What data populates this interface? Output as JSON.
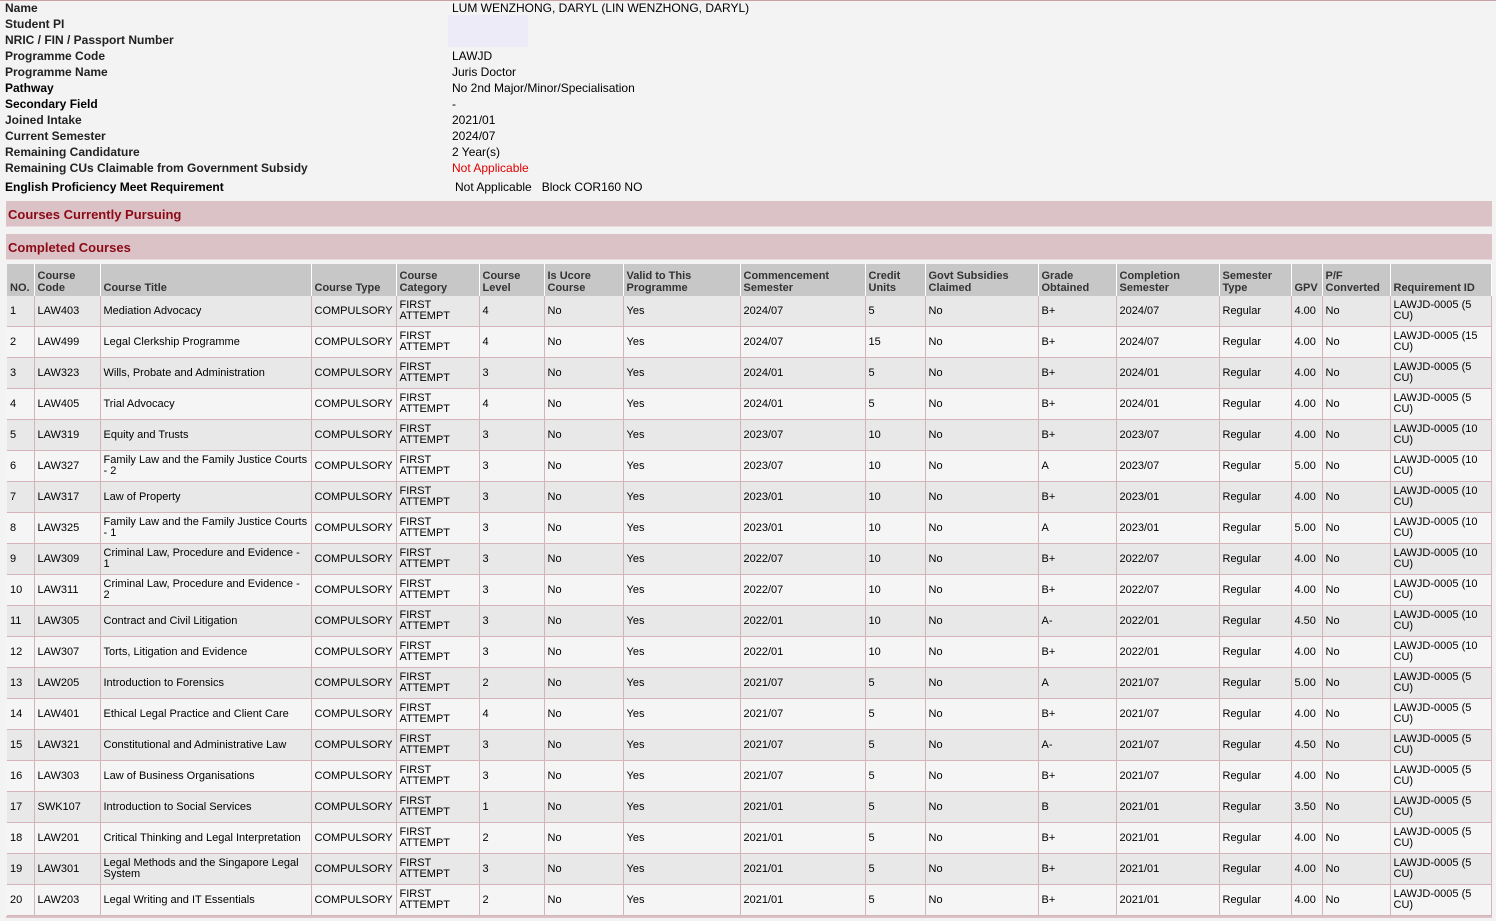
{
  "student_info": [
    {
      "label": "Name",
      "value": "LUM WENZHONG, DARYL (LIN WENZHONG, DARYL)"
    },
    {
      "label": "Student PI",
      "value": ""
    },
    {
      "label": "NRIC / FIN / Passport Number",
      "value": ""
    },
    {
      "label": "Programme Code",
      "value": "LAWJD"
    },
    {
      "label": "Programme Name",
      "value": "Juris Doctor"
    },
    {
      "label": "Pathway",
      "value": "No 2nd Major/Minor/Specialisation"
    },
    {
      "label": "Secondary Field",
      "value": "-"
    },
    {
      "label": "Joined Intake",
      "value": "2021/01"
    },
    {
      "label": "Current Semester",
      "value": "2024/07"
    },
    {
      "label": "Remaining Candidature",
      "value": "2 Year(s)"
    },
    {
      "label": "Remaining CUs Claimable from Government Subsidy",
      "value": "Not Applicable"
    },
    {
      "label": "English Proficiency Meet Requirement",
      "value": "Not Applicable   Block COR160 NO"
    }
  ],
  "sections": {
    "current": "Courses Currently Pursuing",
    "completed": "Completed Courses"
  },
  "columns": [
    "NO.",
    "Course Code",
    "Course Title",
    "Course Type",
    "Course Category",
    "Course Level",
    "Is Ucore Course",
    "Valid to This Programme",
    "Commencement Semester",
    "Credit Units",
    "Govt Subsidies Claimed",
    "Grade Obtained",
    "Completion Semester",
    "Semester Type",
    "GPV",
    "P/F Converted",
    "Requirement ID"
  ],
  "courses": [
    [
      "1",
      "LAW403",
      "Mediation Advocacy",
      "COMPULSORY",
      "FIRST ATTEMPT",
      "4",
      "No",
      "Yes",
      "2024/07",
      "5",
      "No",
      "B+",
      "2024/07",
      "Regular",
      "4.00",
      "No",
      "LAWJD-0005 (5 CU)"
    ],
    [
      "2",
      "LAW499",
      "Legal Clerkship Programme",
      "COMPULSORY",
      "FIRST ATTEMPT",
      "4",
      "No",
      "Yes",
      "2024/07",
      "15",
      "No",
      "B+",
      "2024/07",
      "Regular",
      "4.00",
      "No",
      "LAWJD-0005 (15 CU)"
    ],
    [
      "3",
      "LAW323",
      "Wills, Probate and Administration",
      "COMPULSORY",
      "FIRST ATTEMPT",
      "3",
      "No",
      "Yes",
      "2024/01",
      "5",
      "No",
      "B+",
      "2024/01",
      "Regular",
      "4.00",
      "No",
      "LAWJD-0005 (5 CU)"
    ],
    [
      "4",
      "LAW405",
      "Trial Advocacy",
      "COMPULSORY",
      "FIRST ATTEMPT",
      "4",
      "No",
      "Yes",
      "2024/01",
      "5",
      "No",
      "B+",
      "2024/01",
      "Regular",
      "4.00",
      "No",
      "LAWJD-0005 (5 CU)"
    ],
    [
      "5",
      "LAW319",
      "Equity and Trusts",
      "COMPULSORY",
      "FIRST ATTEMPT",
      "3",
      "No",
      "Yes",
      "2023/07",
      "10",
      "No",
      "B+",
      "2023/07",
      "Regular",
      "4.00",
      "No",
      "LAWJD-0005 (10 CU)"
    ],
    [
      "6",
      "LAW327",
      "Family Law and the Family Justice Courts - 2",
      "COMPULSORY",
      "FIRST ATTEMPT",
      "3",
      "No",
      "Yes",
      "2023/07",
      "10",
      "No",
      "A",
      "2023/07",
      "Regular",
      "5.00",
      "No",
      "LAWJD-0005 (10 CU)"
    ],
    [
      "7",
      "LAW317",
      "Law of Property",
      "COMPULSORY",
      "FIRST ATTEMPT",
      "3",
      "No",
      "Yes",
      "2023/01",
      "10",
      "No",
      "B+",
      "2023/01",
      "Regular",
      "4.00",
      "No",
      "LAWJD-0005 (10 CU)"
    ],
    [
      "8",
      "LAW325",
      "Family Law and the Family Justice Courts - 1",
      "COMPULSORY",
      "FIRST ATTEMPT",
      "3",
      "No",
      "Yes",
      "2023/01",
      "10",
      "No",
      "A",
      "2023/01",
      "Regular",
      "5.00",
      "No",
      "LAWJD-0005 (10 CU)"
    ],
    [
      "9",
      "LAW309",
      "Criminal Law, Procedure and Evidence - 1",
      "COMPULSORY",
      "FIRST ATTEMPT",
      "3",
      "No",
      "Yes",
      "2022/07",
      "10",
      "No",
      "B+",
      "2022/07",
      "Regular",
      "4.00",
      "No",
      "LAWJD-0005 (10 CU)"
    ],
    [
      "10",
      "LAW311",
      "Criminal Law, Procedure and Evidence - 2",
      "COMPULSORY",
      "FIRST ATTEMPT",
      "3",
      "No",
      "Yes",
      "2022/07",
      "10",
      "No",
      "B+",
      "2022/07",
      "Regular",
      "4.00",
      "No",
      "LAWJD-0005 (10 CU)"
    ],
    [
      "11",
      "LAW305",
      "Contract and Civil Litigation",
      "COMPULSORY",
      "FIRST ATTEMPT",
      "3",
      "No",
      "Yes",
      "2022/01",
      "10",
      "No",
      "A-",
      "2022/01",
      "Regular",
      "4.50",
      "No",
      "LAWJD-0005 (10 CU)"
    ],
    [
      "12",
      "LAW307",
      "Torts, Litigation and Evidence",
      "COMPULSORY",
      "FIRST ATTEMPT",
      "3",
      "No",
      "Yes",
      "2022/01",
      "10",
      "No",
      "B+",
      "2022/01",
      "Regular",
      "4.00",
      "No",
      "LAWJD-0005 (10 CU)"
    ],
    [
      "13",
      "LAW205",
      "Introduction to Forensics",
      "COMPULSORY",
      "FIRST ATTEMPT",
      "2",
      "No",
      "Yes",
      "2021/07",
      "5",
      "No",
      "A",
      "2021/07",
      "Regular",
      "5.00",
      "No",
      "LAWJD-0005 (5 CU)"
    ],
    [
      "14",
      "LAW401",
      "Ethical Legal Practice and Client Care",
      "COMPULSORY",
      "FIRST ATTEMPT",
      "4",
      "No",
      "Yes",
      "2021/07",
      "5",
      "No",
      "B+",
      "2021/07",
      "Regular",
      "4.00",
      "No",
      "LAWJD-0005 (5 CU)"
    ],
    [
      "15",
      "LAW321",
      "Constitutional and Administrative Law",
      "COMPULSORY",
      "FIRST ATTEMPT",
      "3",
      "No",
      "Yes",
      "2021/07",
      "5",
      "No",
      "A-",
      "2021/07",
      "Regular",
      "4.50",
      "No",
      "LAWJD-0005 (5 CU)"
    ],
    [
      "16",
      "LAW303",
      "Law of Business Organisations",
      "COMPULSORY",
      "FIRST ATTEMPT",
      "3",
      "No",
      "Yes",
      "2021/07",
      "5",
      "No",
      "B+",
      "2021/07",
      "Regular",
      "4.00",
      "No",
      "LAWJD-0005 (5 CU)"
    ],
    [
      "17",
      "SWK107",
      "Introduction to Social Services",
      "COMPULSORY",
      "FIRST ATTEMPT",
      "1",
      "No",
      "Yes",
      "2021/01",
      "5",
      "No",
      "B",
      "2021/01",
      "Regular",
      "3.50",
      "No",
      "LAWJD-0005 (5 CU)"
    ],
    [
      "18",
      "LAW201",
      "Critical Thinking and Legal Interpretation",
      "COMPULSORY",
      "FIRST ATTEMPT",
      "2",
      "No",
      "Yes",
      "2021/01",
      "5",
      "No",
      "B+",
      "2021/01",
      "Regular",
      "4.00",
      "No",
      "LAWJD-0005 (5 CU)"
    ],
    [
      "19",
      "LAW301",
      "Legal Methods and the Singapore Legal System",
      "COMPULSORY",
      "FIRST ATTEMPT",
      "3",
      "No",
      "Yes",
      "2021/01",
      "5",
      "No",
      "B+",
      "2021/01",
      "Regular",
      "4.00",
      "No",
      "LAWJD-0005 (5 CU)"
    ],
    [
      "20",
      "LAW203",
      "Legal Writing and IT Essentials",
      "COMPULSORY",
      "FIRST ATTEMPT",
      "2",
      "No",
      "Yes",
      "2021/01",
      "5",
      "No",
      "B+",
      "2021/01",
      "Regular",
      "4.00",
      "No",
      "LAWJD-0005 (5 CU)"
    ]
  ]
}
